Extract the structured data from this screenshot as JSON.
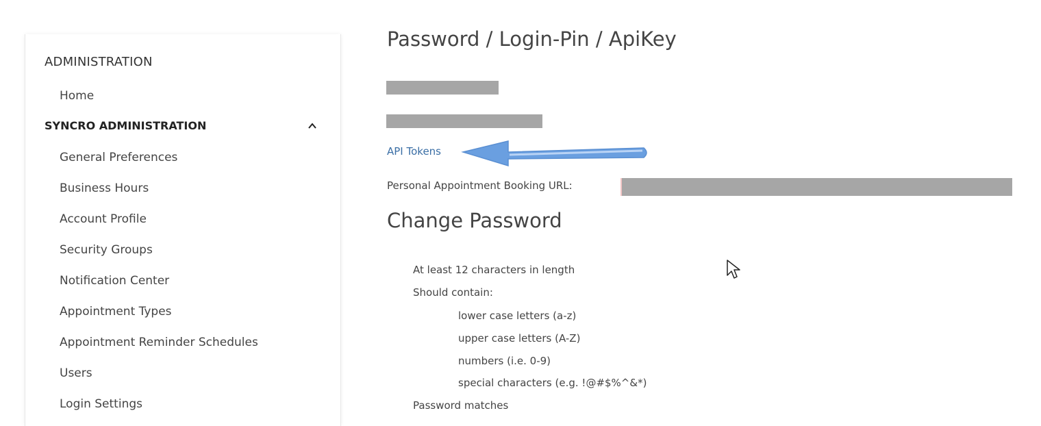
{
  "sidebar": {
    "header": "ADMINISTRATION",
    "home_label": "Home",
    "section_title": "SYNCRO ADMINISTRATION",
    "items": [
      {
        "label": "General Preferences"
      },
      {
        "label": "Business Hours"
      },
      {
        "label": "Account Profile"
      },
      {
        "label": "Security Groups"
      },
      {
        "label": "Notification Center"
      },
      {
        "label": "Appointment Types"
      },
      {
        "label": "Appointment Reminder Schedules"
      },
      {
        "label": "Users"
      },
      {
        "label": "Login Settings"
      }
    ]
  },
  "main": {
    "title": "Password / Login-Pin / ApiKey",
    "api_tokens_link": "API Tokens",
    "booking_url_label": "Personal Appointment Booking URL:",
    "change_password_title": "Change Password",
    "requirements": {
      "length": "At least 12 characters in length",
      "should_contain": "Should contain:",
      "lowercase": "lower case letters (a-z)",
      "uppercase": "upper case letters (A-Z)",
      "numbers": "numbers (i.e. 0-9)",
      "special": "special characters (e.g. !@#$%^&*)",
      "matches": "Password matches"
    }
  },
  "icons": {
    "collapse": "chevron-up-icon",
    "annotation": "arrow-left-icon",
    "pointer": "mouse-cursor-icon"
  },
  "colors": {
    "link": "#3a6ea5",
    "annotation_arrow": "#6a9fe0",
    "redaction": "#a6a6a6"
  }
}
